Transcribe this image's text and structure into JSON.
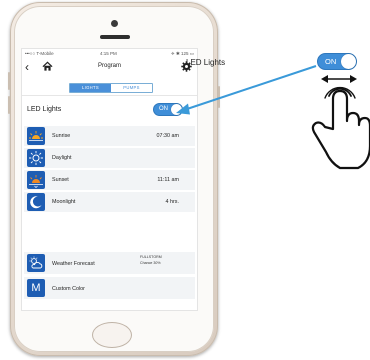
{
  "status_bar": {
    "carrier": "•••○○ T-Mobile",
    "time": "4:15 PM",
    "battery": "✈ ✱ 125 ▭"
  },
  "nav": {
    "back_glyph": "‹",
    "title": "Program"
  },
  "tabs": [
    {
      "label": "LIGHTS",
      "active": true
    },
    {
      "label": "PUMPS",
      "active": false
    }
  ],
  "led": {
    "label": "LED Lights",
    "toggle_label": "ON"
  },
  "rows": [
    {
      "label": "Sunrise",
      "value": "07:30 am",
      "icon": "sunrise-icon"
    },
    {
      "label": "Daylight",
      "value": "",
      "icon": "sun-icon"
    },
    {
      "label": "Sunset",
      "value": "11:11 am",
      "icon": "sunset-icon"
    },
    {
      "label": "Moonlight",
      "value": "4 hrs.",
      "icon": "moon-icon"
    }
  ],
  "weather": {
    "label": "Weather Forecast",
    "value_line1": "FULLSTORM",
    "value_line2": "Chance 30%",
    "icon": "weather-cloud-sun-icon"
  },
  "custom_color": {
    "label": "Custom Color",
    "icon_letter": "M"
  },
  "callout": {
    "label": "LED Lights",
    "toggle_label": "ON"
  },
  "colors": {
    "accent": "#3f8ed8",
    "icon_bg": "#1e5db3",
    "arrow": "#3a9ad9"
  }
}
